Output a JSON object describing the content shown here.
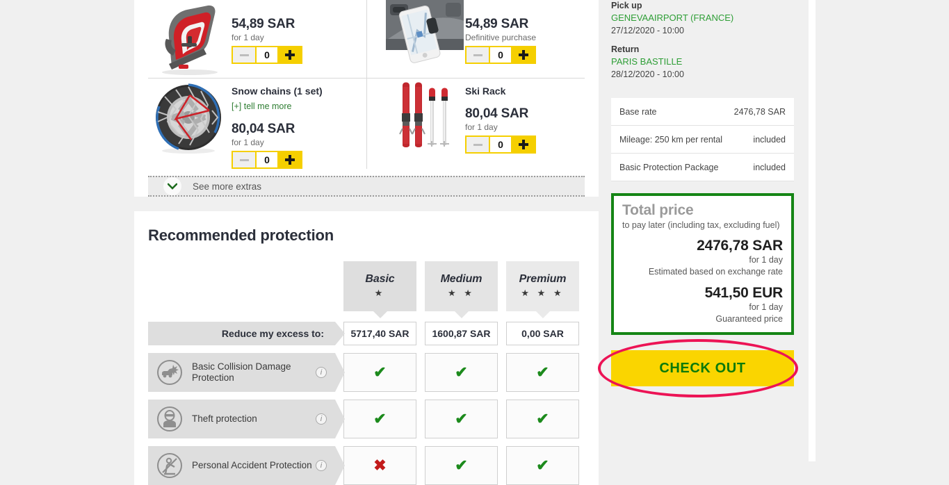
{
  "extras": {
    "items": [
      {
        "name": "",
        "price": "54,89 SAR",
        "sub": "for 1 day",
        "qty": "0",
        "link": "",
        "icon": "child-seat-image"
      },
      {
        "name": "",
        "price": "54,89 SAR",
        "sub": "Definitive purchase",
        "qty": "0",
        "link": "",
        "icon": "phone-holder-image"
      },
      {
        "name": "Snow chains (1 set)",
        "price": "80,04 SAR",
        "sub": "for 1 day",
        "qty": "0",
        "link": "[+] tell me more",
        "icon": "snow-chains-image"
      },
      {
        "name": "Ski Rack",
        "price": "80,04 SAR",
        "sub": "for 1 day",
        "qty": "0",
        "link": "",
        "icon": "ski-rack-image"
      }
    ],
    "see_more_label": "See more extras",
    "minus_label": "−",
    "plus_label": "+"
  },
  "protection": {
    "title": "Recommended protection",
    "plans": [
      {
        "name": "Basic",
        "stars": "★"
      },
      {
        "name": "Medium",
        "stars": "★ ★"
      },
      {
        "name": "Premium",
        "stars": "★ ★ ★"
      }
    ],
    "excess_row": {
      "label": "Reduce my excess to:",
      "values": [
        "5717,40 SAR",
        "1600,87 SAR",
        "0,00 SAR"
      ]
    },
    "features": [
      {
        "name": "Basic Collision Damage Protection",
        "icon": "car-crash-icon",
        "info": "i",
        "values": [
          "✔",
          "✔",
          "✔"
        ]
      },
      {
        "name": "Theft protection",
        "icon": "thief-icon",
        "info": "i",
        "values": [
          "✔",
          "✔",
          "✔"
        ]
      },
      {
        "name": "Personal Accident Protection",
        "icon": "seatbelt-accident-icon",
        "info": "i",
        "values": [
          "✖",
          "✔",
          "✔"
        ]
      }
    ]
  },
  "sidebar": {
    "pickup_label": "Pick up",
    "pickup_place": "GENEVAAIRPORT (FRANCE)",
    "pickup_date": "27/12/2020 - 10:00",
    "return_label": "Return",
    "return_place": "PARIS BASTILLE",
    "return_date": "28/12/2020 - 10:00",
    "rates": [
      {
        "label": "Base rate",
        "value": "2476,78 SAR"
      },
      {
        "label": "Mileage: 250 km per rental",
        "value": "included"
      },
      {
        "label": "Basic Protection Package",
        "value": "included"
      }
    ],
    "total": {
      "title": "Total price",
      "note": "to pay later (including tax, excluding fuel)",
      "primary_amount": "2476,78 SAR",
      "primary_period": "for 1 day",
      "primary_note": "Estimated based on exchange rate",
      "secondary_amount": "541,50 EUR",
      "secondary_period": "for 1 day",
      "secondary_note": "Guaranteed price"
    },
    "checkout_label": "CHECK OUT"
  },
  "colors": {
    "accent_yellow": "#fad500",
    "green": "#158515",
    "annotation_pink": "#ec1355",
    "page_bg": "#f0f0f0"
  }
}
